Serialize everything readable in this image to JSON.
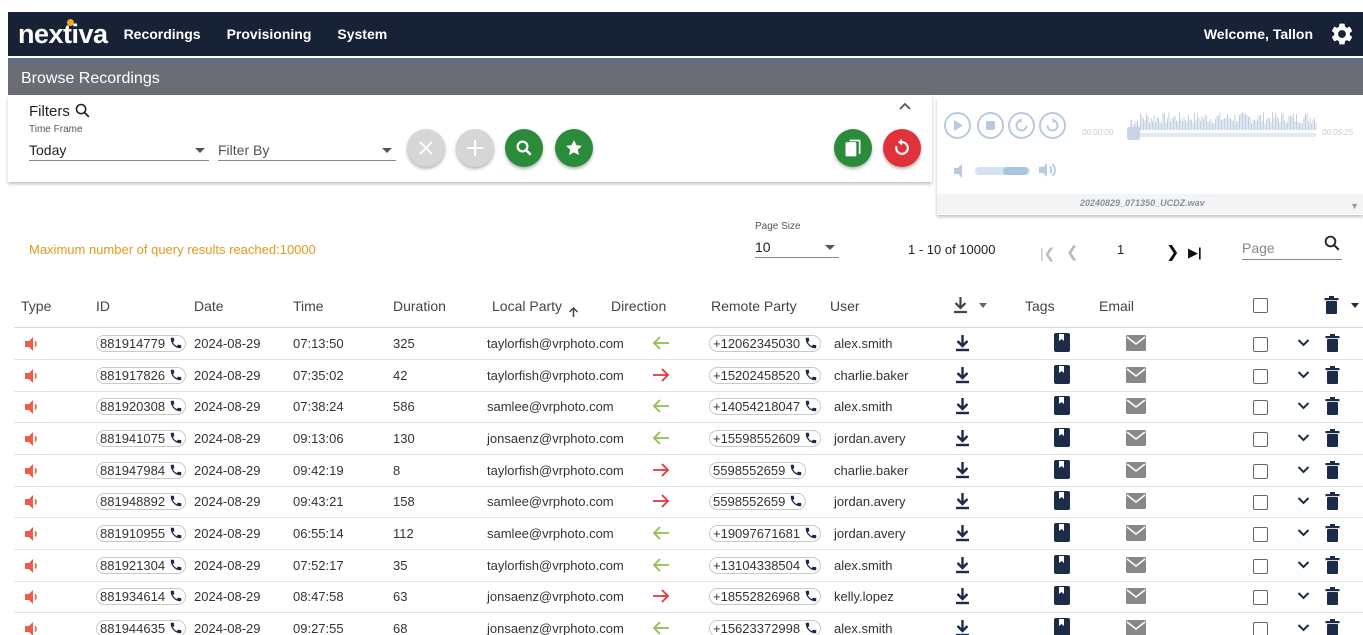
{
  "app": {
    "logo": "nextiva",
    "welcome": "Welcome, Tallon"
  },
  "nav": [
    {
      "label": "Recordings"
    },
    {
      "label": "Provisioning"
    },
    {
      "label": "System"
    }
  ],
  "page_title": "Browse Recordings",
  "filters": {
    "title": "Filters",
    "timeframe_label": "Time Frame",
    "timeframe_value": "Today",
    "filterby_placeholder": "Filter By"
  },
  "player": {
    "time_start": "00:00:00",
    "time_end": "00:05:25",
    "filename": "20240829_071350_UCDZ.wav"
  },
  "pagination": {
    "max_message": "Maximum number of query results reached:10000",
    "page_size_label": "Page Size",
    "page_size": "10",
    "range": "1 - 10 of 10000",
    "current_page": "1",
    "page_placeholder": "Page"
  },
  "table": {
    "headers": {
      "type": "Type",
      "id": "ID",
      "date": "Date",
      "time": "Time",
      "duration": "Duration",
      "local_party": "Local Party",
      "direction": "Direction",
      "remote_party": "Remote Party",
      "user": "User",
      "tags": "Tags",
      "email": "Email"
    },
    "colors": {
      "inbound": "#8cc152",
      "outbound": "#e8353b",
      "speaker": "#e8604c",
      "icon": "#1c2b48"
    },
    "rows": [
      {
        "id": "881914779",
        "date": "2024-08-29",
        "time": "07:13:50",
        "duration": "325",
        "local": "taylorfish@vrphoto.com",
        "direction": "in",
        "remote": "+12062345030",
        "user": "alex.smith"
      },
      {
        "id": "881917826",
        "date": "2024-08-29",
        "time": "07:35:02",
        "duration": "42",
        "local": "taylorfish@vrphoto.com",
        "direction": "out",
        "remote": "+15202458520",
        "user": "charlie.baker"
      },
      {
        "id": "881920308",
        "date": "2024-08-29",
        "time": "07:38:24",
        "duration": "586",
        "local": "samlee@vrphoto.com",
        "direction": "in",
        "remote": "+14054218047",
        "user": "alex.smith"
      },
      {
        "id": "881941075",
        "date": "2024-08-29",
        "time": "09:13:06",
        "duration": "130",
        "local": "jonsaenz@vrphoto.com",
        "direction": "in",
        "remote": "+15598552609",
        "user": "jordan.avery"
      },
      {
        "id": "881947984",
        "date": "2024-08-29",
        "time": "09:42:19",
        "duration": "8",
        "local": "taylorfish@vrphoto.com",
        "direction": "out",
        "remote": "5598552659",
        "user": "charlie.baker"
      },
      {
        "id": "881948892",
        "date": "2024-08-29",
        "time": "09:43:21",
        "duration": "158",
        "local": "samlee@vrphoto.com",
        "direction": "out",
        "remote": "5598552659",
        "user": "jordan.avery"
      },
      {
        "id": "881910955",
        "date": "2024-08-29",
        "time": "06:55:14",
        "duration": "112",
        "local": "samlee@vrphoto.com",
        "direction": "in",
        "remote": "+19097671681",
        "user": "jordan.avery"
      },
      {
        "id": "881921304",
        "date": "2024-08-29",
        "time": "07:52:17",
        "duration": "35",
        "local": "taylorfish@vrphoto.com",
        "direction": "in",
        "remote": "+13104338504",
        "user": "alex.smith"
      },
      {
        "id": "881934614",
        "date": "2024-08-29",
        "time": "08:47:58",
        "duration": "63",
        "local": "jonsaenz@vrphoto.com",
        "direction": "out",
        "remote": "+18552826968",
        "user": "kelly.lopez"
      },
      {
        "id": "881944635",
        "date": "2024-08-29",
        "time": "09:27:55",
        "duration": "68",
        "local": "jonsaenz@vrphoto.com",
        "direction": "in",
        "remote": "+15623372998",
        "user": "alex.smith"
      }
    ]
  }
}
